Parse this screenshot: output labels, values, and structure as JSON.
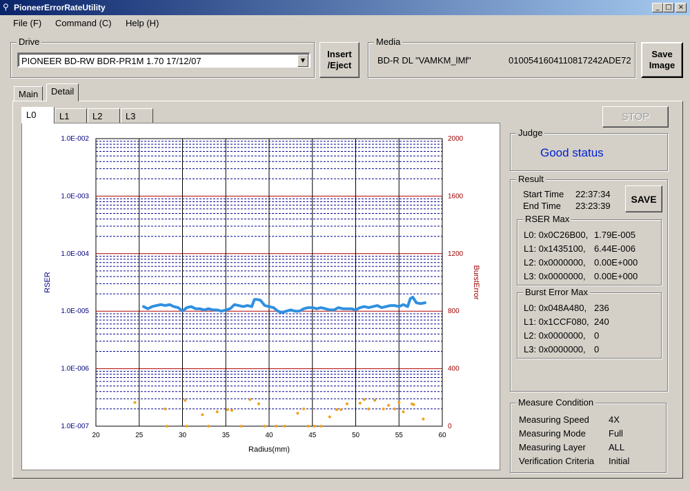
{
  "window": {
    "title": "PioneerErrorRateUtility",
    "min": "_",
    "max": "□",
    "close": "×"
  },
  "menu": {
    "file": "File (F)",
    "command": "Command (C)",
    "help": "Help (H)"
  },
  "drive": {
    "label": "Drive",
    "value": "PIONEER BD-RW BDR-PR1M  1.70 17/12/07"
  },
  "insert_eject": {
    "line1": "Insert",
    "line2": "/Eject"
  },
  "media": {
    "label": "Media",
    "type": "BD-R DL \"VAMKM_lMf\"",
    "id": "0100541604110817242ADE72"
  },
  "save_image": {
    "line1": "Save",
    "line2": "Image"
  },
  "tabs": {
    "main": "Main",
    "detail": "Detail"
  },
  "layer_tabs": [
    "L0",
    "L1",
    "L2",
    "L3"
  ],
  "stop_label": "STOP",
  "judge": {
    "label": "Judge",
    "status": "Good status",
    "status_color": "#0020d0"
  },
  "result": {
    "label": "Result",
    "start_label": "Start Time",
    "start_value": "22:37:34",
    "end_label": "End Time",
    "end_value": "23:23:39",
    "save_label": "SAVE",
    "rser_max": {
      "label": "RSER Max",
      "rows": [
        {
          "addr": "L0: 0x0C26B00,",
          "val": "1.79E-005"
        },
        {
          "addr": "L1: 0x1435100,",
          "val": "6.44E-006"
        },
        {
          "addr": "L2: 0x0000000,",
          "val": "0.00E+000"
        },
        {
          "addr": "L3: 0x0000000,",
          "val": "0.00E+000"
        }
      ]
    },
    "burst_max": {
      "label": "Burst Error Max",
      "rows": [
        {
          "addr": "L0: 0x048A480,",
          "val": "236"
        },
        {
          "addr": "L1: 0x1CCF080,",
          "val": "240"
        },
        {
          "addr": "L2: 0x0000000,",
          "val": "0"
        },
        {
          "addr": "L3: 0x0000000,",
          "val": "0"
        }
      ]
    }
  },
  "measure": {
    "label": "Measure Condition",
    "rows": [
      {
        "k": "Measuring Speed",
        "v": "4X"
      },
      {
        "k": "Measuring Mode",
        "v": "Full"
      },
      {
        "k": "Measuring Layer",
        "v": "ALL"
      },
      {
        "k": "Verification Criteria",
        "v": "Initial"
      }
    ]
  },
  "chart_data": {
    "type": "line",
    "xlabel": "Radius(mm)",
    "ylabel_left": "RSER",
    "ylabel_right": "BurstError",
    "x_ticks": [
      "20",
      "25",
      "30",
      "35",
      "40",
      "45",
      "50",
      "55",
      "60"
    ],
    "xlim": [
      20,
      60
    ],
    "y_left_ticks": [
      "1.0E-002",
      "1.0E-003",
      "1.0E-004",
      "1.0E-005",
      "1.0E-006",
      "1.0E-007"
    ],
    "ylim_left_log10": [
      -7,
      -2
    ],
    "y_right_ticks": [
      "2000",
      "1600",
      "1200",
      "800",
      "400",
      "0"
    ],
    "ylim_right": [
      0,
      2000
    ],
    "colors": {
      "rser": "#3090e0",
      "burst": "#f0a020",
      "left_axis": "#000080",
      "right_axis": "#a00000"
    },
    "series": [
      {
        "name": "RSER",
        "axis": "left",
        "x": [
          25.5,
          26,
          26.5,
          27,
          27.5,
          28,
          28.5,
          29,
          29.5,
          30,
          30.5,
          31,
          31.5,
          32,
          32.5,
          33,
          33.5,
          34,
          34.5,
          35,
          35.5,
          36,
          36.5,
          37,
          37.5,
          38,
          38.3,
          38.6,
          39,
          39.5,
          40,
          40.5,
          41,
          41.5,
          42,
          42.5,
          43,
          43.5,
          44,
          44.5,
          45,
          45.5,
          46,
          46.5,
          47,
          47.5,
          48,
          48.5,
          49,
          49.5,
          50,
          50.5,
          51,
          51.5,
          52,
          52.5,
          53,
          53.5,
          54,
          54.5,
          55,
          55.5,
          56,
          56.3,
          56.6,
          57,
          57.5,
          58
        ],
        "y": [
          1.2e-05,
          1.1e-05,
          1.2e-05,
          1.25e-05,
          1.3e-05,
          1.25e-05,
          1.3e-05,
          1.2e-05,
          1.15e-05,
          1e-05,
          1.15e-05,
          1.2e-05,
          1.1e-05,
          1.1e-05,
          1.05e-05,
          1.1e-05,
          1.05e-05,
          1.05e-05,
          1e-05,
          1.05e-05,
          1.1e-05,
          1.3e-05,
          1.25e-05,
          1.2e-05,
          1.25e-05,
          1.2e-05,
          1.6e-05,
          1.6e-05,
          1.55e-05,
          1.25e-05,
          1.2e-05,
          1.15e-05,
          1e-05,
          9.5e-06,
          1e-05,
          1.05e-05,
          1e-05,
          1e-05,
          1.1e-05,
          1.15e-05,
          1.15e-05,
          1.1e-05,
          1.15e-05,
          1.1e-05,
          1.05e-05,
          1.05e-05,
          1.15e-05,
          1.1e-05,
          1.1e-05,
          1.1e-05,
          1.05e-05,
          1.15e-05,
          1.2e-05,
          1.15e-05,
          1.2e-05,
          1.25e-05,
          1.15e-05,
          1.2e-05,
          1.25e-05,
          1.25e-05,
          1.2e-05,
          1.3e-05,
          1.2e-05,
          1.65e-05,
          1.75e-05,
          1.4e-05,
          1.35e-05,
          1.4e-05
        ]
      },
      {
        "name": "BurstError",
        "axis": "right",
        "x": [
          24.5,
          28,
          28.2,
          30.3,
          30.5,
          32.3,
          33,
          34,
          35.2,
          35.7,
          36.8,
          37.8,
          38.8,
          39.5,
          40.8,
          41.8,
          43.3,
          44,
          44.5,
          45.2,
          46,
          47,
          47.8,
          48.3,
          49,
          50.5,
          51,
          51.5,
          52.2,
          53.2,
          53.8,
          54.5,
          55,
          55.5,
          56.5,
          56.7,
          57.8
        ],
        "y": [
          165,
          120,
          0,
          180,
          0,
          80,
          0,
          100,
          115,
          110,
          0,
          185,
          155,
          0,
          0,
          0,
          90,
          120,
          0,
          0,
          0,
          65,
          115,
          115,
          155,
          160,
          185,
          120,
          180,
          120,
          145,
          120,
          165,
          100,
          155,
          150,
          50
        ]
      }
    ]
  }
}
